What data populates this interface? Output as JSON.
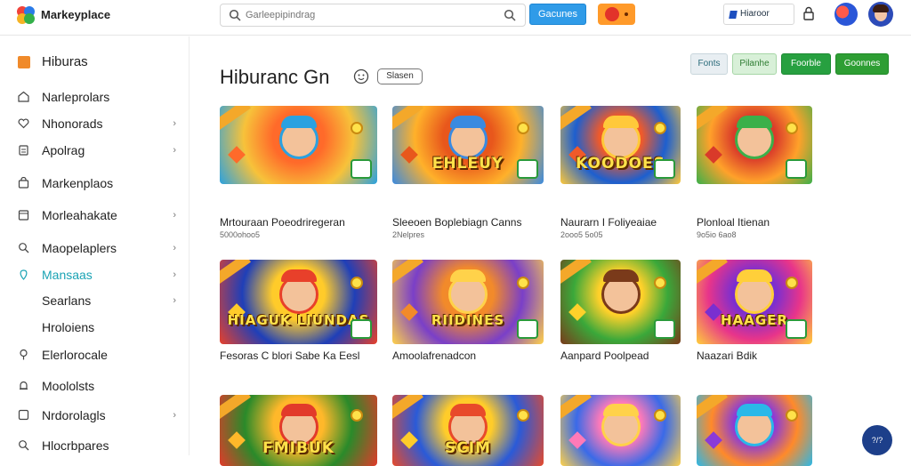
{
  "header": {
    "app_name": "Markeyplace",
    "search_placeholder": "Garleepipindrag",
    "primary_button": "Gacunes",
    "select_value": "Hiaroor",
    "icons": [
      "logo-icon",
      "search-icon",
      "search-submit-icon",
      "lock-icon",
      "avatar",
      "user-avatar"
    ]
  },
  "sidebar": {
    "heading": "Hiburas",
    "items": [
      {
        "label": "Narleprolars",
        "icon": "home-icon",
        "chevron": ""
      },
      {
        "label": "Nhonorads",
        "icon": "heart-icon",
        "chevron": "›"
      },
      {
        "label": "Apolrag",
        "icon": "clipboard-icon",
        "chevron": "›"
      },
      {
        "label": "Markenplaos",
        "icon": "bag-icon",
        "chevron": ""
      },
      {
        "label": "Morleahakate",
        "icon": "box-icon",
        "chevron": "›"
      },
      {
        "label": "Maopelaplers",
        "icon": "search-icon",
        "chevron": "›"
      },
      {
        "label": "Mansaas",
        "icon": "location-icon",
        "chevron": "›"
      },
      {
        "label": "Searlans",
        "icon": "",
        "chevron": "›"
      },
      {
        "label": "Hroloiens",
        "icon": "",
        "chevron": ""
      },
      {
        "label": "Elerlorocale",
        "icon": "pin-icon",
        "chevron": ""
      },
      {
        "label": "Moololsts",
        "icon": "bell-icon",
        "chevron": ""
      },
      {
        "label": "Nrdorolagls",
        "icon": "grid-icon",
        "chevron": "›"
      },
      {
        "label": "Hlocrbpares",
        "icon": "search-icon",
        "chevron": ""
      }
    ]
  },
  "main": {
    "title": "Hiburanc Gn",
    "pill": "Slasen",
    "filters": [
      "Fonts",
      "Pilanhe",
      "Foorble",
      "Goonnes"
    ],
    "cards": [
      {
        "name": "Mrtouraan Poeodriregeran",
        "meta": "5000ohoo5",
        "wordmark": ""
      },
      {
        "name": "Sleeoen Boplebiagn Canns",
        "meta": "2Nelpres",
        "wordmark": "EHLEUY"
      },
      {
        "name": "Naurarn I Foliyeaiae",
        "meta": "2ooo5 5o05",
        "wordmark": "KOODOES"
      },
      {
        "name": "Plonloal Itienan",
        "meta": "9o5io 6ao8",
        "wordmark": ""
      },
      {
        "name": "Fesoras C blori Sabe Ka Eesl",
        "meta": "",
        "wordmark": "HIAGUK LIUNDAS"
      },
      {
        "name": "Amoolafrenadcon",
        "meta": "",
        "wordmark": "RIIDINES"
      },
      {
        "name": "Aanpard Poolpead",
        "meta": "",
        "wordmark": ""
      },
      {
        "name": "Naazari Bdik",
        "meta": "",
        "wordmark": "HAAGER"
      },
      {
        "name": "",
        "meta": "",
        "wordmark": "FMIBUK"
      },
      {
        "name": "",
        "meta": "",
        "wordmark": "SCIM"
      },
      {
        "name": "",
        "meta": "",
        "wordmark": ""
      },
      {
        "name": "",
        "meta": "",
        "wordmark": ""
      }
    ],
    "help": "?/?"
  },
  "colors": {
    "accent_blue": "#2f9be8",
    "active_teal": "#1aa3b4",
    "green": "#27a040",
    "orange": "#f08a2a"
  }
}
